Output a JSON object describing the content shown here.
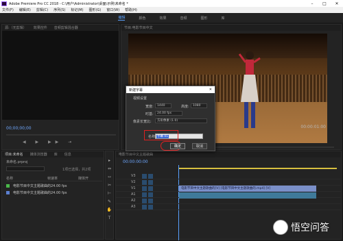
{
  "titlebar": {
    "title": "Adobe Premiere Pro CC 2018 - C:\\用户\\Administrator\\桌面\\示例\\未命名 *",
    "min": "–",
    "max": "□",
    "close": "✕"
  },
  "menubar": [
    "文件(F)",
    "编辑(E)",
    "剪辑(C)",
    "序列(S)",
    "标记(M)",
    "图形(G)",
    "窗口(W)",
    "帮助(H)"
  ],
  "workspaces": [
    {
      "label": "编辑",
      "active": true
    },
    {
      "label": "颜色",
      "active": false
    },
    {
      "label": "效果",
      "active": false
    },
    {
      "label": "音频",
      "active": false
    },
    {
      "label": "图形",
      "active": false
    },
    {
      "label": "库",
      "active": false
    }
  ],
  "source_monitor": {
    "tabs": [
      "源:（无剪辑）",
      "效果控件",
      "音频剪辑混合器"
    ],
    "timecode": "00;00;00;00",
    "controls": "◀ ▶ ▶▶ ⇥"
  },
  "program_monitor": {
    "tabs": [
      "节目:电影节目中文"
    ],
    "timecode": "00:00:01:00",
    "controls": "◀◀ ◀ ▶ ▶ ▶▶ ⇥"
  },
  "project": {
    "tabs": [
      "项目:未命名",
      "媒体浏览器",
      "库",
      "信息"
    ],
    "file": "未命名.prproj",
    "count": "1项已选择，共2项",
    "headers": [
      "名称",
      "帧速率",
      "媒体开"
    ],
    "rows": [
      {
        "name": "电影节目中文主题歌曲的",
        "rate": "24.00 fps",
        "color": "#4ab84a"
      },
      {
        "name": "电影节目中文主题歌曲的",
        "rate": "24.00 fps",
        "color": "#5b7fd0"
      }
    ]
  },
  "tools": [
    "▸",
    "⇔",
    "⇿",
    "✂",
    "⊢",
    "✎",
    "✋",
    "T"
  ],
  "timeline": {
    "tab": "电影节目中文主题歌曲",
    "timecode": "00:00:00:00",
    "tracks": [
      "V3",
      "V2",
      "V1",
      "A1",
      "A2",
      "A3"
    ],
    "clip_label": "电影节目中文主题歌曲的[V] [电影节目中文主题歌曲的.mp4] [V]"
  },
  "dialog": {
    "title": "新建字幕",
    "close": "✕",
    "section": "视频设置",
    "width_label": "宽度:",
    "width_value": "1440",
    "height_label": "高度:",
    "height_value": "1080",
    "timebase_label": "时基:",
    "timebase_value": "24.00 fps",
    "pixel_label": "像素长宽比:",
    "pixel_value": "方形像素 (1.0)",
    "name_label": "名称",
    "name_value": "字幕 01",
    "ok": "确定",
    "cancel": "取消"
  },
  "watermark": {
    "text": "悟空问答"
  }
}
